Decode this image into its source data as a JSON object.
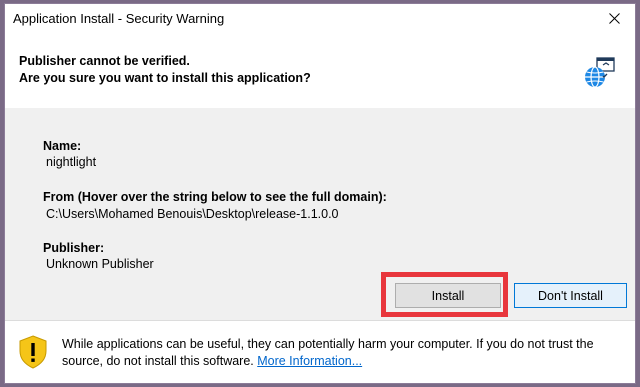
{
  "window": {
    "title": "Application Install - Security Warning",
    "close_icon": "close-icon"
  },
  "header": {
    "line1": "Publisher cannot be verified.",
    "line2": "Are you sure you want to install this application?",
    "icon": "globe-install-icon"
  },
  "details": {
    "name_label": "Name:",
    "name_value": "nightlight",
    "from_label": "From (Hover over the string below to see the full domain):",
    "from_value": "C:\\Users\\Mohamed Benouis\\Desktop\\release-1.1.0.0",
    "publisher_label": "Publisher:",
    "publisher_value": "Unknown Publisher"
  },
  "buttons": {
    "install": "Install",
    "dont_install": "Don't Install"
  },
  "footer": {
    "icon": "shield-warning-icon",
    "text": "While applications can be useful, they can potentially harm your computer. If you do not trust the source, do not install this software. ",
    "link": "More Information..."
  },
  "colors": {
    "highlight": "#e8363c",
    "accent": "#0078d7",
    "link": "#0066cc",
    "shield": "#f5c518"
  }
}
